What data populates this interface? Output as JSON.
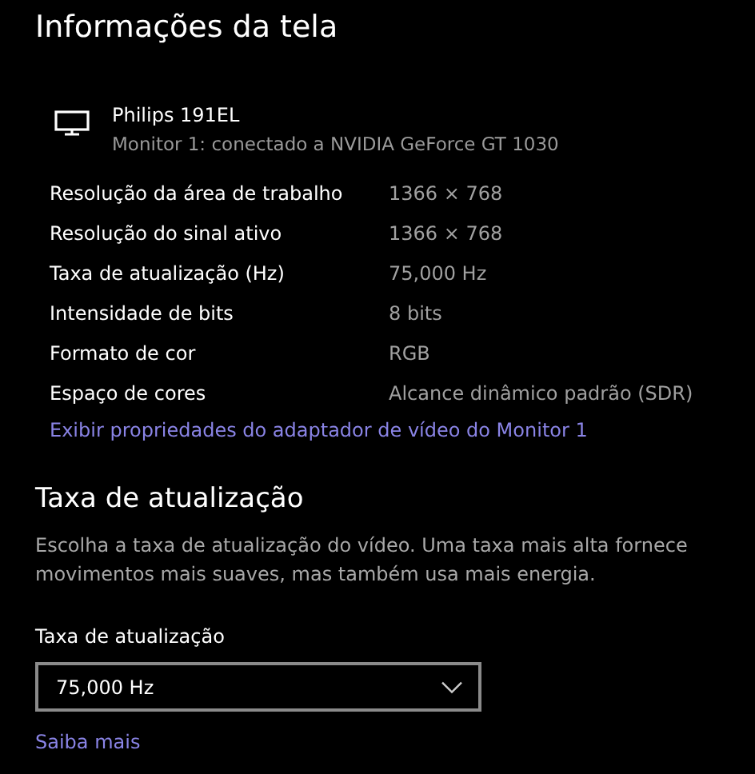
{
  "title": "Informações da tela",
  "monitor": {
    "name": "Philips 191EL",
    "subtitle": "Monitor 1: conectado a NVIDIA GeForce GT 1030"
  },
  "properties": [
    {
      "label": "Resolução da área de trabalho",
      "value": "1366 × 768"
    },
    {
      "label": "Resolução do sinal ativo",
      "value": "1366 × 768"
    },
    {
      "label": "Taxa de atualização (Hz)",
      "value": "75,000 Hz"
    },
    {
      "label": "Intensidade de bits",
      "value": "8 bits"
    },
    {
      "label": "Formato de cor",
      "value": "RGB"
    },
    {
      "label": "Espaço de cores",
      "value": "Alcance dinâmico padrão (SDR)"
    }
  ],
  "adapter_link": "Exibir propriedades do adaptador de vídeo do Monitor 1",
  "refresh": {
    "heading": "Taxa de atualização",
    "description": "Escolha a taxa de atualização do vídeo. Uma taxa mais alta fornece movimentos mais suaves, mas também usa mais energia.",
    "dropdown_label": "Taxa de atualização",
    "dropdown_value": "75,000 Hz",
    "link": "Saiba mais"
  }
}
